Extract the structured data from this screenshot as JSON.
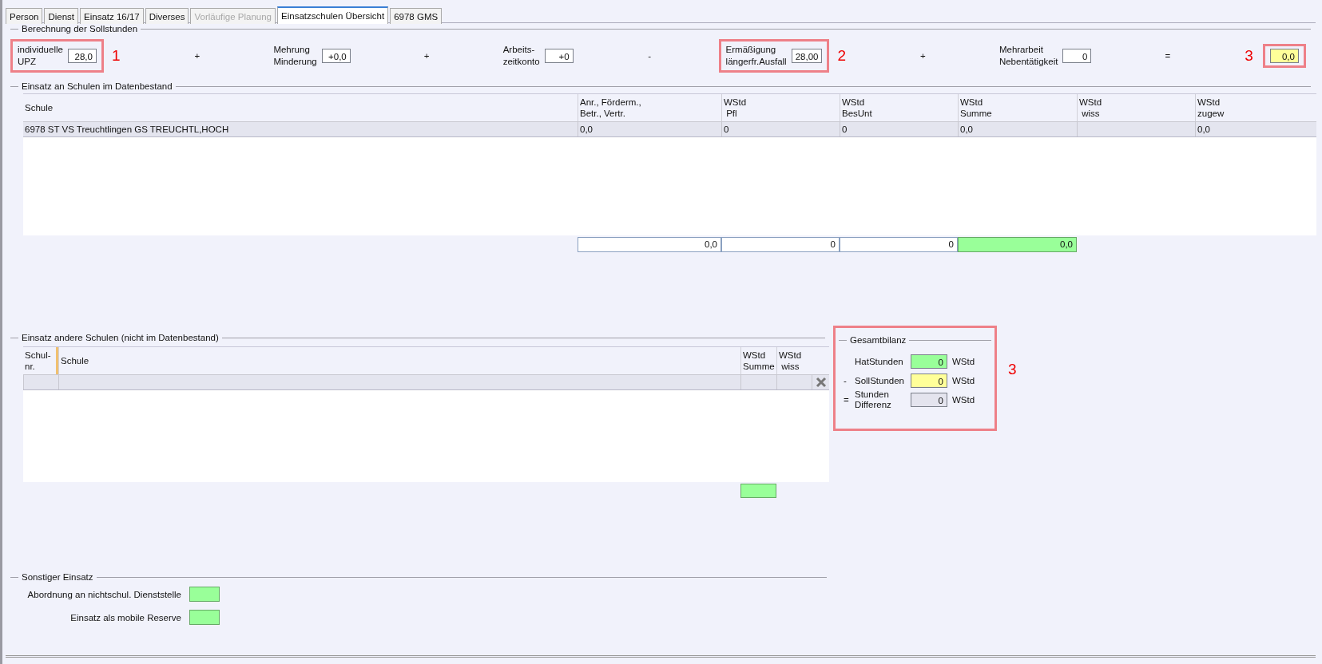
{
  "tabs": [
    {
      "label": "Person",
      "selected": false,
      "disabled": false
    },
    {
      "label": "Dienst",
      "selected": false,
      "disabled": false
    },
    {
      "label": "Einsatz 16/17",
      "selected": false,
      "disabled": false
    },
    {
      "label": "Diverses",
      "selected": false,
      "disabled": false
    },
    {
      "label": "Vorläufige Planung",
      "selected": false,
      "disabled": true
    },
    {
      "label": "Einsatzschulen Übersicht",
      "selected": true,
      "disabled": false
    },
    {
      "label": "6978 GMS",
      "selected": false,
      "disabled": false
    }
  ],
  "sollstunden": {
    "title": "Berechnung der Sollstunden",
    "terms": [
      {
        "label": "individuelle\nUPZ",
        "value": "28,0",
        "highlighted": false,
        "annotated": true,
        "marker": "1",
        "marker_before": false
      },
      {
        "operator": "+",
        "label": "Mehrung\nMinderung",
        "value": "+0,0",
        "highlighted": false,
        "annotated": false
      },
      {
        "operator": "+",
        "label": "Arbeits-\nzeitkonto",
        "value": "+0",
        "highlighted": false,
        "annotated": false
      },
      {
        "operator": "-",
        "label": "Ermäßigung\nlängerfr.Ausfall",
        "value": "28,00",
        "highlighted": false,
        "annotated": true,
        "marker": "2",
        "marker_before": false
      },
      {
        "operator": "+",
        "label": "Mehrarbeit\nNebentätigkeit",
        "value": "0",
        "highlighted": false,
        "annotated": false
      },
      {
        "operator": "=",
        "value": "0,0",
        "highlighted": true,
        "annotated": true,
        "marker": "3",
        "marker_before": true
      }
    ]
  },
  "einsatz_datenbestand": {
    "title": "Einsatz an Schulen im Datenbestand",
    "columns": [
      "Schule",
      "Anr., Förderm.,\nBetr., Vertr.",
      "WStd\n Pfl",
      "WStd\nBesUnt",
      "WStd\nSumme",
      "WStd\n wiss",
      "WStd\nzugew"
    ],
    "rows": [
      {
        "selected": true,
        "cells": [
          "6978 ST VS Treuchtlingen GS TREUCHTL,HOCH",
          "0,0",
          "0",
          "0",
          "0,0",
          null,
          "0,0"
        ]
      }
    ],
    "totals": [
      {
        "value": "0,0",
        "highlighted": false
      },
      {
        "value": "0",
        "highlighted": false
      },
      {
        "value": "0",
        "highlighted": false
      },
      {
        "value": "0,0",
        "highlighted": true
      }
    ]
  },
  "einsatz_andere": {
    "title": "Einsatz andere Schulen (nicht im Datenbestand)",
    "columns": [
      "Schul-\nnr.",
      "Schule",
      "WStd\nSumme",
      "WStd\n wiss"
    ]
  },
  "gesamtbilanz": {
    "title": "Gesamtbilanz",
    "annotated": true,
    "marker": "3",
    "rows": [
      {
        "operator": null,
        "label": "HatStunden",
        "value": "0",
        "unit": "WStd",
        "color": "#99ff99"
      },
      {
        "operator": "-",
        "label": "SollStunden",
        "value": "0",
        "unit": "WStd",
        "color": "#ffff99"
      },
      {
        "operator": "=",
        "label": "Stunden\nDifferenz",
        "value": "0",
        "unit": "WStd",
        "color": "#e4e4ee"
      }
    ]
  },
  "sonstiger": {
    "title": "Sonstiger Einsatz",
    "rows": [
      {
        "label": "Abordnung an nichtschul. Dienststelle"
      },
      {
        "label": "Einsatz als mobile Reserve"
      }
    ]
  }
}
